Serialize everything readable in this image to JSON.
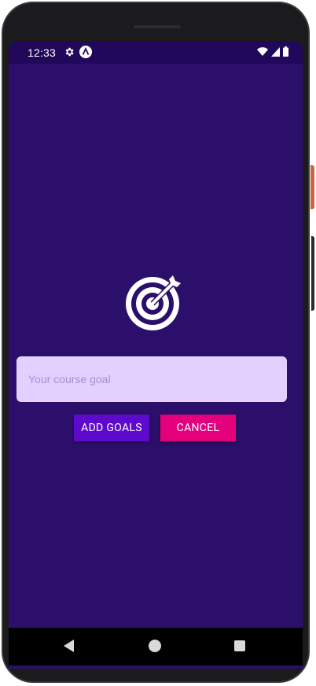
{
  "status_bar": {
    "time": "12:33",
    "icons": [
      "gear-icon",
      "app-a-icon",
      "wifi-icon",
      "signal-icon",
      "battery-icon"
    ]
  },
  "goal_screen": {
    "image_icon": "target-dart-icon",
    "input": {
      "placeholder": "Your course goal",
      "value": ""
    },
    "add_button_label": "ADD GOALS",
    "cancel_button_label": "CANCEL"
  },
  "nav_bar": {
    "icons": [
      "back-icon",
      "home-icon",
      "recents-icon"
    ]
  },
  "colors": {
    "background": "#2c0f6b",
    "status_bar": "#21085a",
    "input_background": "#e4d0ff",
    "add_button": "#5e0acc",
    "cancel_button": "#e4007d"
  }
}
